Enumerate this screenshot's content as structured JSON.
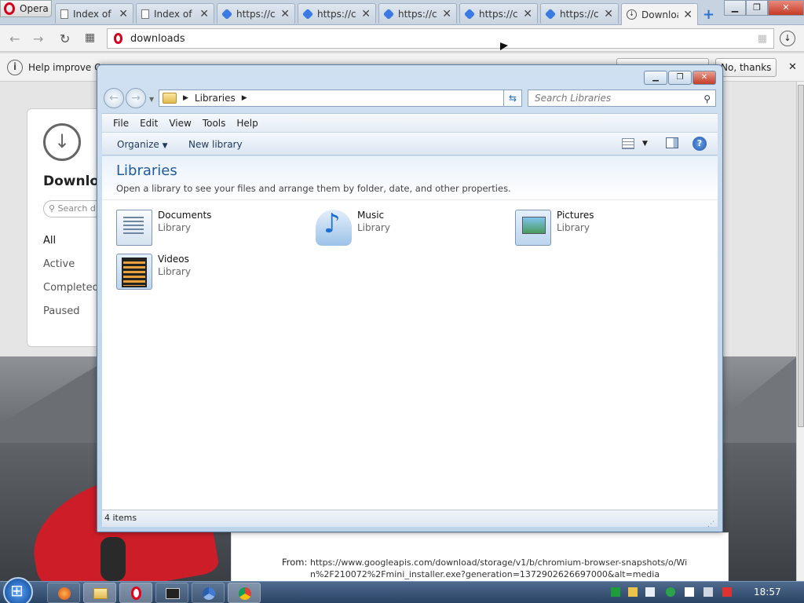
{
  "browser": {
    "opera_label": "Opera",
    "tabs": [
      {
        "label": "Index of",
        "icon": "page-icon"
      },
      {
        "label": "Index of",
        "icon": "page-icon"
      },
      {
        "label": "https://c",
        "icon": "chromium-icon"
      },
      {
        "label": "https://c",
        "icon": "chromium-icon"
      },
      {
        "label": "https://c",
        "icon": "chromium-icon"
      },
      {
        "label": "https://c",
        "icon": "chromium-icon"
      },
      {
        "label": "https://c",
        "icon": "chromium-icon"
      },
      {
        "label": "Downloa",
        "icon": "download-icon",
        "active": true
      }
    ],
    "address": "downloads",
    "infobar": {
      "text": "Help improve Op",
      "no_thanks": "No, thanks"
    }
  },
  "downloads_page": {
    "title": "Downloa",
    "search_placeholder": "Search d",
    "nav": [
      "All",
      "Active",
      "Completed",
      "Paused"
    ],
    "from_label": "From:",
    "from_url": "https://www.googleapis.com/download/storage/v1/b/chromium-browser-snapshots/o/Win%2F210072%2Fmini_installer.exe?generation=1372902626697000&alt=media"
  },
  "explorer": {
    "breadcrumb": "Libraries",
    "search_placeholder": "Search Libraries",
    "menu": [
      "File",
      "Edit",
      "View",
      "Tools",
      "Help"
    ],
    "toolbar": {
      "organize": "Organize",
      "new_library": "New library"
    },
    "heading": "Libraries",
    "subheading": "Open a library to see your files and arrange them by folder, date, and other properties.",
    "libraries": [
      {
        "name": "Documents",
        "type": "Library",
        "icon": "documents-library-icon"
      },
      {
        "name": "Music",
        "type": "Library",
        "icon": "music-library-icon"
      },
      {
        "name": "Pictures",
        "type": "Library",
        "icon": "pictures-library-icon"
      },
      {
        "name": "Videos",
        "type": "Library",
        "icon": "videos-library-icon"
      }
    ],
    "status": "4 items"
  },
  "taskbar": {
    "clock": "18:57"
  }
}
